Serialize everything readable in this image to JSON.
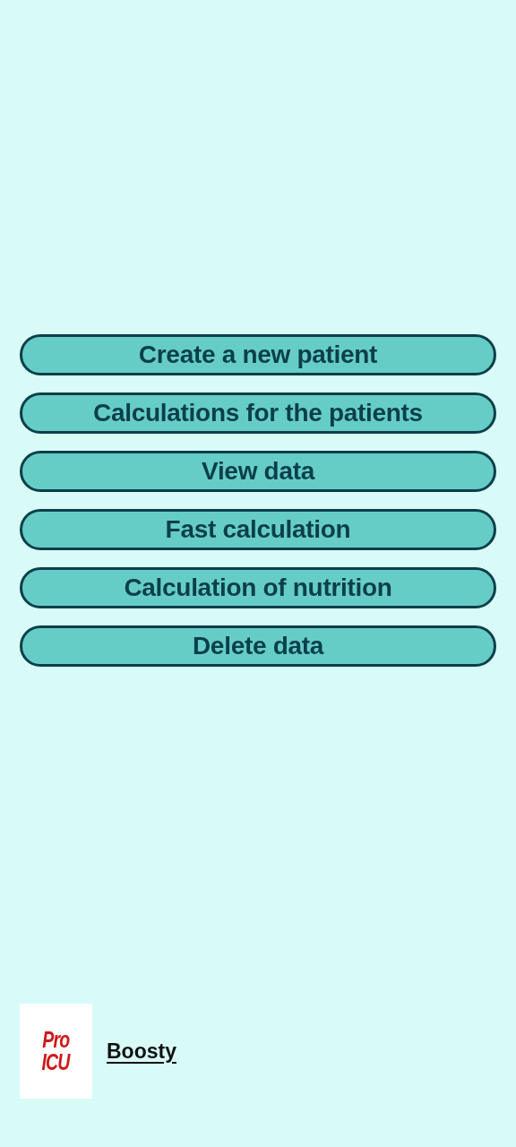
{
  "menu": [
    {
      "label": "Create a new patient"
    },
    {
      "label": "Calculations for the patients"
    },
    {
      "label": "View data"
    },
    {
      "label": "Fast calculation"
    },
    {
      "label": "Calculation of nutrition"
    },
    {
      "label": "Delete data"
    }
  ],
  "footer": {
    "logo_lines": [
      "Pro",
      "ICU"
    ],
    "link": "Boosty"
  }
}
